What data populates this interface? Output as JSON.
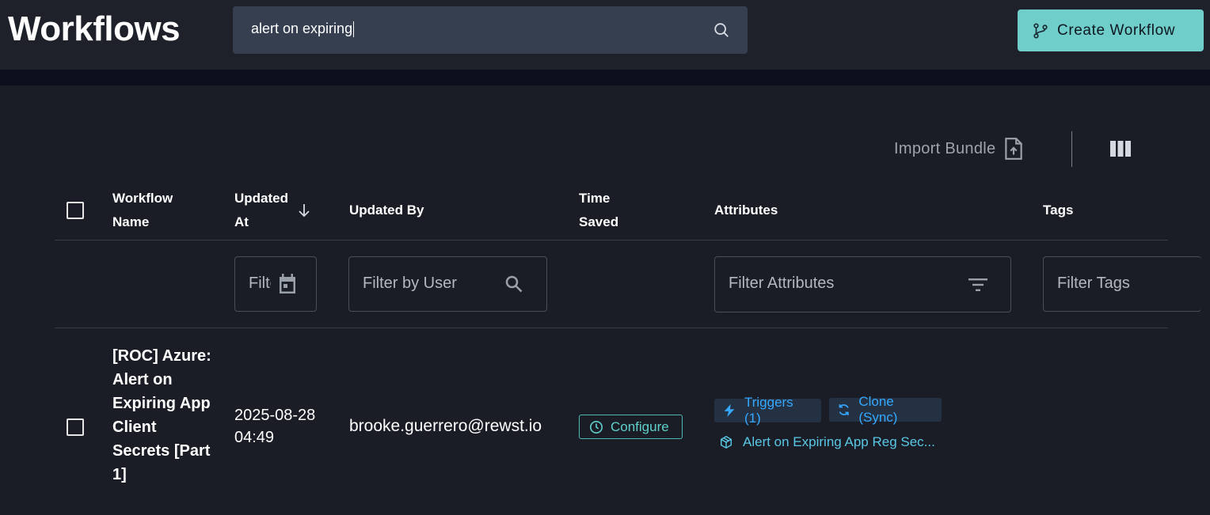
{
  "header": {
    "title": "Workflows",
    "search_value": "alert on expiring",
    "create_label": "Create Workflow"
  },
  "toolbar": {
    "import_label": "Import Bundle"
  },
  "table": {
    "columns": {
      "name_line1": "Workflow",
      "name_line2": "Name",
      "updated_at_line1": "Updated",
      "updated_at_line2": "At",
      "updated_by": "Updated By",
      "time_saved_line1": "Time",
      "time_saved_line2": "Saved",
      "attributes": "Attributes",
      "tags": "Tags"
    },
    "filters": {
      "date_placeholder": "Filter",
      "user_placeholder": "Filter by User",
      "attributes_placeholder": "Filter Attributes",
      "tags_placeholder": "Filter Tags"
    },
    "rows": [
      {
        "name": "[ROC] Azure: Alert on Expiring App Client Secrets [Part 1]",
        "updated_at": "2025-08-28 04:49",
        "updated_by": "brooke.guerrero@rewst.io",
        "time_saved": "Configure",
        "triggers": "Triggers (1)",
        "clone": "Clone (Sync)",
        "bundle": "Alert on Expiring App Reg Sec..."
      }
    ]
  },
  "colors": {
    "accent": "#6fcdca",
    "chip_text": "#35a8ff",
    "background": "#1b1d26"
  }
}
